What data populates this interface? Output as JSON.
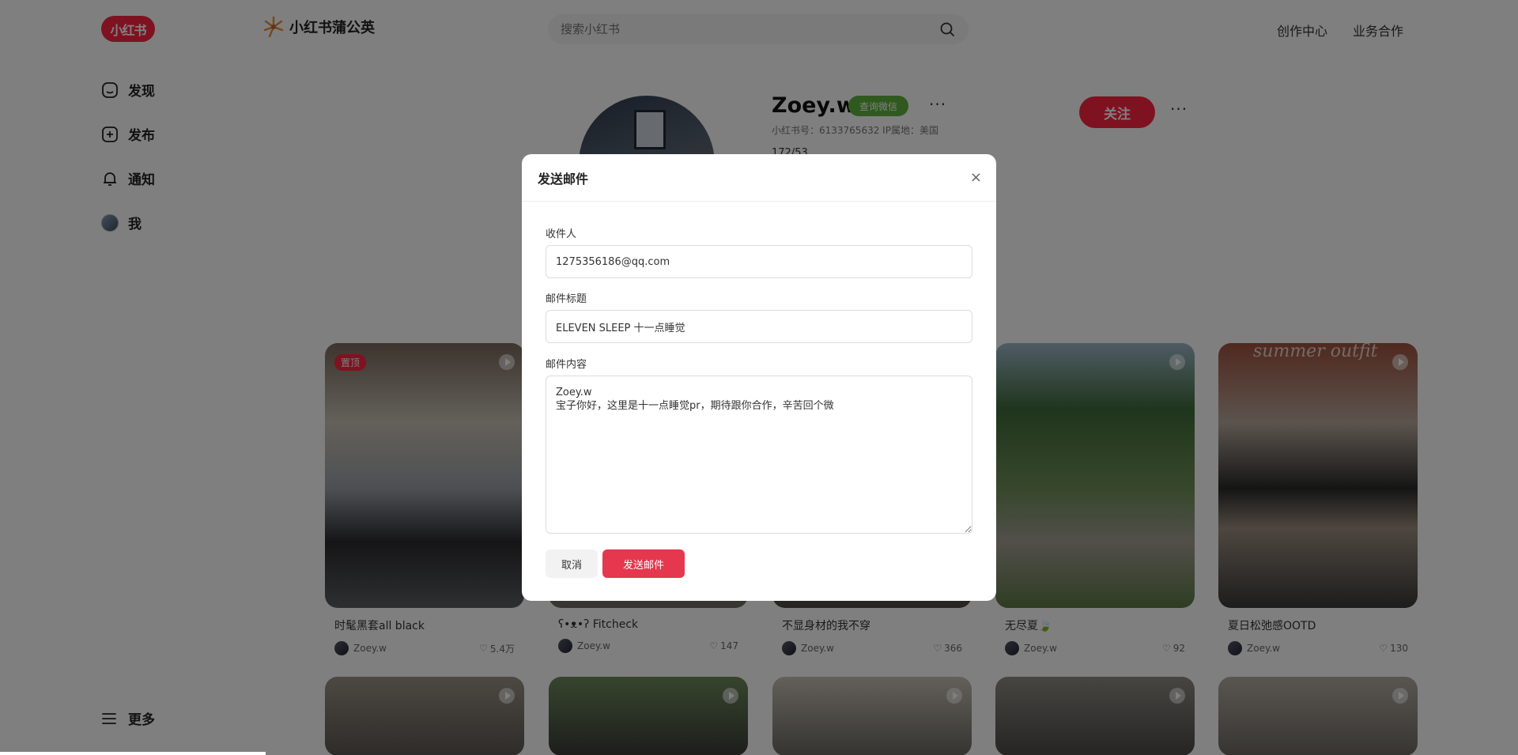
{
  "header": {
    "logo_text": "小红书",
    "brand_name": "小红书蒲公英",
    "search_placeholder": "搜索小红书",
    "links": [
      "创作中心",
      "业务合作"
    ]
  },
  "sidebar": {
    "items": [
      {
        "label": "发现",
        "icon": "home-icon"
      },
      {
        "label": "发布",
        "icon": "plus-square-icon"
      },
      {
        "label": "通知",
        "icon": "bell-icon"
      },
      {
        "label": "我",
        "icon": "avatar"
      }
    ],
    "more_label": "更多"
  },
  "profile": {
    "name": "Zoey.w",
    "wechat_badge": "查询微信",
    "info": "小红书号：6133765632   IP属地：美国",
    "stats_partial": "172/53",
    "follow_label": "关注"
  },
  "notes": [
    {
      "title": "时髦黑套all black",
      "author": "Zoey.w",
      "likes": "5.4万",
      "pinned": "置顶"
    },
    {
      "title": "ʕ•ᴥ•ʔ Fitcheck",
      "author": "Zoey.w",
      "likes": "147"
    },
    {
      "title": "不显身材的我不穿",
      "author": "Zoey.w",
      "likes": "366"
    },
    {
      "title": "无尽夏🍃",
      "author": "Zoey.w",
      "likes": "92"
    },
    {
      "title": "夏日松弛感OOTD",
      "author": "Zoey.w",
      "likes": "130",
      "overlay_text": "summer outfit"
    }
  ],
  "modal": {
    "title": "发送邮件",
    "close": "×",
    "recipient_label": "收件人",
    "recipient_value": "1275356186@qq.com",
    "subject_label": "邮件标题",
    "subject_value": "ELEVEN SLEEP 十一点睡觉",
    "content_label": "邮件内容",
    "content_value": "Zoey.w\n宝子你好，这里是十一点睡觉pr，期待跟你合作，辛苦回个微",
    "cancel_label": "取消",
    "send_label": "发送邮件"
  },
  "colors": {
    "brand_red": "#ff2442",
    "send_red": "#e5374d",
    "wechat_green": "#5fb23c"
  }
}
